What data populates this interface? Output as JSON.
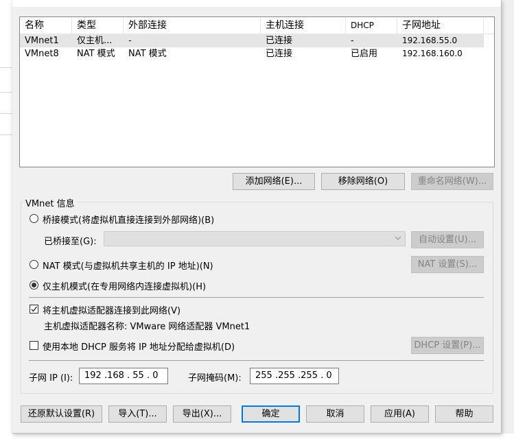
{
  "network_list": {
    "columns": [
      "名称",
      "类型",
      "外部连接",
      "主机连接",
      "DHCP",
      "子网地址"
    ],
    "rows": [
      {
        "name": "VMnet1",
        "type": "仅主机...",
        "external": "-",
        "host": "已连接",
        "dhcp": "-",
        "subnet": "192.168.55.0"
      },
      {
        "name": "VMnet8",
        "type": "NAT 模式",
        "external": "NAT 模式",
        "host": "已连接",
        "dhcp": "已启用",
        "subnet": "192.168.160.0"
      }
    ]
  },
  "list_buttons": {
    "add": "添加网络(E)...",
    "remove": "移除网络(O)",
    "rename": "重命名网络(W)..."
  },
  "vmnet_info": {
    "title": "VMnet 信息",
    "bridged_label": "桥接模式(将虚拟机直接连接到外部网络)(B)",
    "bridged_to_label": "已桥接至(G):",
    "bridged_to_value": "",
    "auto_settings": "自动设置(U)...",
    "nat_label": "NAT 模式(与虚拟机共享主机的 IP 地址)(N)",
    "nat_settings": "NAT 设置(S)...",
    "hostonly_label": "仅主机模式(在专用网络内连接虚拟机)(H)",
    "selected_mode": "hostonly",
    "connect_adapter_label": "将主机虚拟适配器连接到此网络(V)",
    "connect_adapter_checked": true,
    "adapter_name_text": "主机虚拟适配器名称: VMware 网络适配器 VMnet1",
    "dhcp_label": "使用本地 DHCP 服务将 IP 地址分配给虚拟机(D)",
    "dhcp_checked": false,
    "dhcp_settings": "DHCP 设置(P)...",
    "subnet_ip_label": "子网 IP (I):",
    "subnet_ip_value": "192 .168 . 55  .  0",
    "subnet_mask_label": "子网掩码(M):",
    "subnet_mask_value": "255 .255 .255 .  0"
  },
  "footer": {
    "restore": "还原默认设置(R)",
    "import": "导入(T)...",
    "export": "导出(X)...",
    "ok": "确定",
    "cancel": "取消",
    "apply": "应用(A)",
    "help": "帮助"
  },
  "colors": {
    "default_button_border": "#0078d7",
    "selected_row": "#e5e5e5",
    "dialog_bg": "#f0f0f0"
  }
}
